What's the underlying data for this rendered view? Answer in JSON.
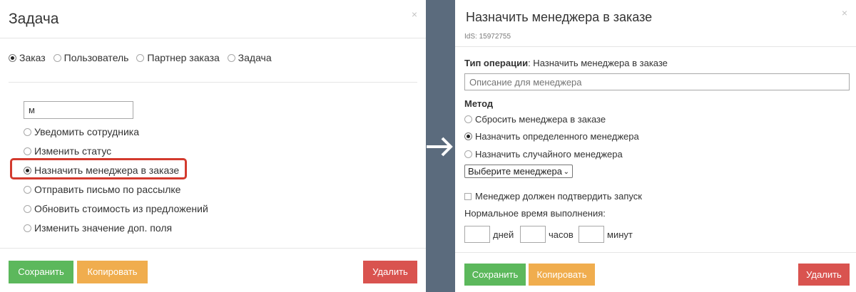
{
  "left_dialog": {
    "title": "Задача",
    "close": "×",
    "object_types": [
      {
        "label": "Заказ",
        "selected": true
      },
      {
        "label": "Пользователь",
        "selected": false
      },
      {
        "label": "Партнер заказа",
        "selected": false
      },
      {
        "label": "Задача",
        "selected": false
      }
    ],
    "search_value": "м",
    "actions": [
      {
        "label": "Уведомить сотрудника",
        "selected": false
      },
      {
        "label": "Изменить статус",
        "selected": false
      },
      {
        "label": "Назначить менеджера в заказе",
        "selected": true
      },
      {
        "label": "Отправить письмо по рассылке",
        "selected": false
      },
      {
        "label": "Обновить стоимость из предложений",
        "selected": false
      },
      {
        "label": "Изменить значение доп. поля",
        "selected": false
      }
    ],
    "save_label": "Сохранить",
    "copy_label": "Копировать",
    "delete_label": "Удалить"
  },
  "right_dialog": {
    "title": "Назначить менеджера в заказе",
    "close": "×",
    "ids": "IdS: 15972755",
    "operation_type_label": "Тип операции",
    "operation_type_value": ": Назначить менеджера в заказе",
    "description_placeholder": "Описание для менеджера",
    "method_label": "Метод",
    "methods": [
      {
        "label": "Сбросить менеджера в заказе",
        "selected": false
      },
      {
        "label": "Назначить определенного менеджера",
        "selected": true
      },
      {
        "label": "Назначить случайного менеджера",
        "selected": false
      }
    ],
    "manager_select": "Выберите менеджера",
    "confirm_checkbox_label": "Менеджер должен подтвердить запуск",
    "normal_time_label": "Нормальное время выполнения:",
    "days_label": "дней",
    "hours_label": "часов",
    "minutes_label": "минут",
    "save_label": "Сохранить",
    "copy_label": "Копировать",
    "delete_label": "Удалить"
  },
  "colors": {
    "save": "#5cb85c",
    "copy": "#f0ad4e",
    "delete": "#d9534f",
    "highlight": "#d33a2e",
    "backdrop": "#5b6b7d"
  },
  "icons": {
    "close": "close-icon",
    "arrow": "arrow-right-icon",
    "select_chevron": "chevron-down-icon"
  }
}
